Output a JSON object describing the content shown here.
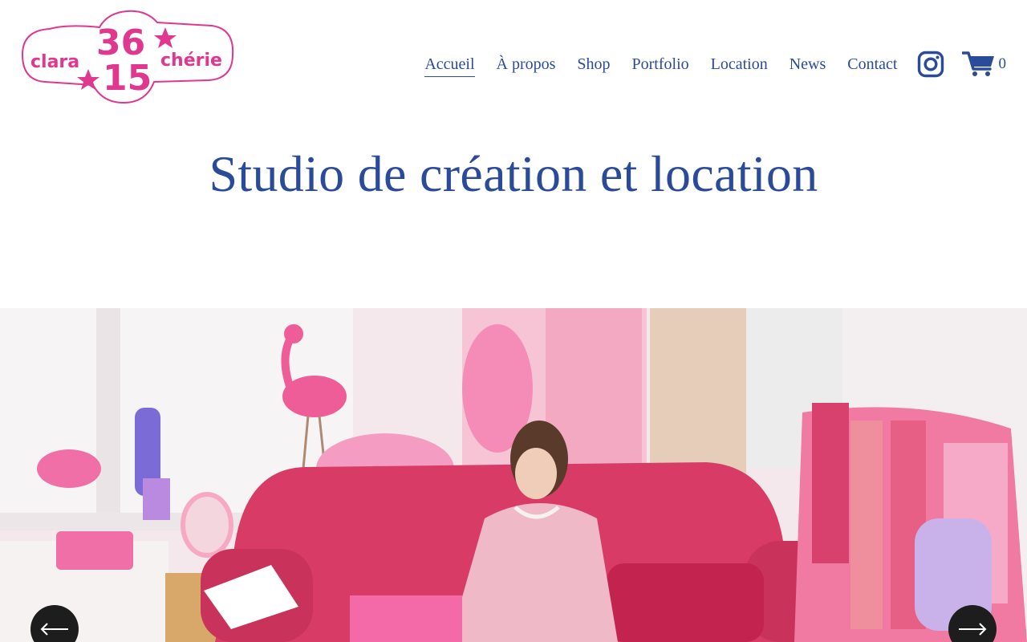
{
  "brand": {
    "line1": "36",
    "line2": "15",
    "left_word": "clara",
    "right_word": "chérie",
    "color": "#e0378f"
  },
  "nav": {
    "items": [
      {
        "label": "Accueil",
        "active": true
      },
      {
        "label": "À propos",
        "active": false
      },
      {
        "label": "Shop",
        "active": false
      },
      {
        "label": "Portfolio",
        "active": false
      },
      {
        "label": "Location",
        "active": false
      },
      {
        "label": "News",
        "active": false
      },
      {
        "label": "Contact",
        "active": false
      }
    ],
    "instagram_icon": "instagram-icon",
    "cart_icon": "shopping-cart-icon",
    "cart_count": "0"
  },
  "hero": {
    "title": "Studio de création et location"
  },
  "slideshow": {
    "prev_icon": "arrow-left-icon",
    "next_icon": "arrow-right-icon"
  },
  "colors": {
    "text": "#2a4a9a",
    "brand_pink": "#e0378f",
    "arrow_bg": "#1d1d1d"
  }
}
